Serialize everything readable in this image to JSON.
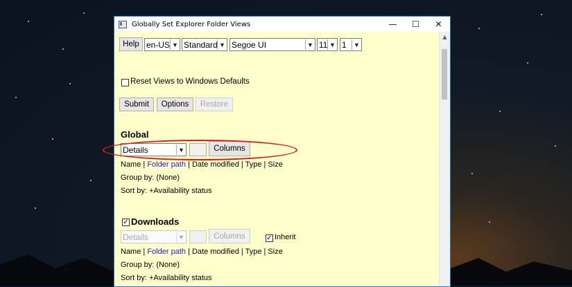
{
  "window": {
    "title": "Globally Set Explorer Folder Views",
    "minimize_glyph": "—",
    "maximize_glyph": "☐",
    "close_glyph": "✕"
  },
  "toolbar": {
    "help_label": "Help",
    "locale_value": "en-US",
    "style_value": "Standard",
    "font_value": "Segoe UI",
    "size_value": "11",
    "scale_value": "1"
  },
  "reset_label": "Reset Views to Windows Defaults",
  "actions": {
    "submit_label": "Submit",
    "options_label": "Options",
    "restore_label": "Restore"
  },
  "global": {
    "heading": "Global",
    "view_value": "Details",
    "columns_label": "Columns",
    "columns": {
      "name": "Name",
      "sep1": " | ",
      "folder_path": "Folder path",
      "sep2": " | ",
      "rest": "Date modified | Type | Size"
    },
    "group_by": "Group by: (None)",
    "sort_by": "Sort by: +Availability status"
  },
  "downloads": {
    "heading": "Downloads",
    "checked": true,
    "view_value": "Details",
    "columns_label": "Columns",
    "inherit_label": "Inherit",
    "inherit_checked": true,
    "columns": {
      "name": "Name",
      "sep1": " | ",
      "folder_path": "Folder path",
      "sep2": " | ",
      "rest": "Date modified | Type | Size"
    },
    "group_by": "Group by: (None)",
    "sort_by": "Sort by: +Availability status"
  },
  "colors": {
    "panel_background": "#ffffcc",
    "link": "#1a1ae6",
    "annotation_red": "#d81d1d",
    "window_border": "#2b78d4"
  },
  "icons": {
    "app": "app-window-icon",
    "dropdown": "chevron-down-icon",
    "scroll_up": "scroll-up-arrow-icon",
    "check": "checkmark-icon"
  }
}
